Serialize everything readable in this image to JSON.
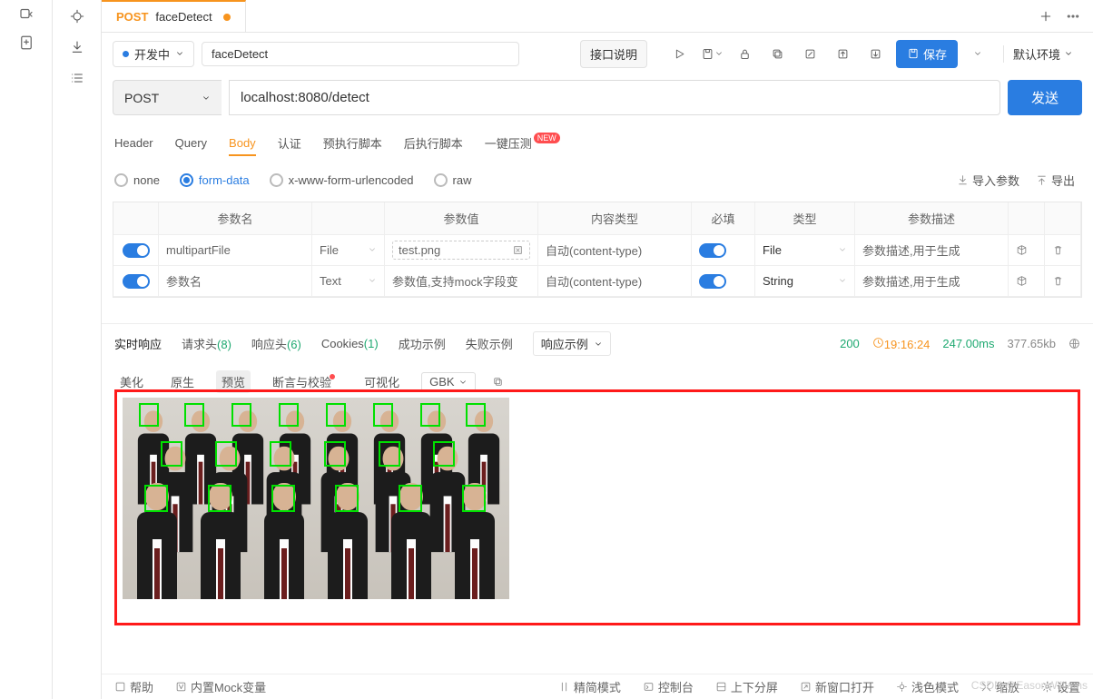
{
  "tab": {
    "method": "POST",
    "name": "faceDetect"
  },
  "status_pill": {
    "label": "开发中"
  },
  "api_name": "faceDetect",
  "desc_btn": "接口说明",
  "save_btn": "保存",
  "env": "默认环境",
  "method": "POST",
  "url": "localhost:8080/detect",
  "send": "发送",
  "req_tabs": [
    "Header",
    "Query",
    "Body",
    "认证",
    "预执行脚本",
    "后执行脚本",
    "一键压测"
  ],
  "body_types": [
    "none",
    "form-data",
    "x-www-form-urlencoded",
    "raw"
  ],
  "links": {
    "import": "导入参数",
    "export": "导出"
  },
  "table": {
    "headers": [
      "",
      "参数名",
      "",
      "参数值",
      "内容类型",
      "必填",
      "类型",
      "参数描述",
      "",
      ""
    ],
    "rows": [
      {
        "name": "multipartFile",
        "kind": "File",
        "value": "test.png",
        "content_type": "自动(content-type)",
        "type": "File",
        "desc_ph": "参数描述,用于生成"
      },
      {
        "name_ph": "参数名",
        "kind": "Text",
        "value_ph": "参数值,支持mock字段变",
        "content_type": "自动(content-type)",
        "type": "String",
        "desc_ph": "参数描述,用于生成"
      }
    ]
  },
  "resp_tabs": {
    "realtime": "实时响应",
    "reqh": "请求头",
    "reqh_cnt": "(8)",
    "resh": "响应头",
    "resh_cnt": "(6)",
    "cookies": "Cookies",
    "cookies_cnt": "(1)",
    "ok": "成功示例",
    "fail": "失败示例",
    "example": "响应示例"
  },
  "resp_stats": {
    "code": "200",
    "clock": "19:16:24",
    "ms": "247.00ms",
    "size": "377.65kb"
  },
  "resp_toolbar": {
    "beautify": "美化",
    "raw": "原生",
    "preview": "预览",
    "assert": "断言与校验",
    "viz": "可视化",
    "enc": "GBK"
  },
  "footer": {
    "help": "帮助",
    "mock": "内置Mock变量",
    "compact": "精简模式",
    "console": "控制台",
    "split": "上下分屏",
    "newwin": "新窗口打开",
    "light": "浅色模式",
    "zoom": "缩放",
    "settings": "设置"
  },
  "watermark": "CSDN @EasonWilliams"
}
